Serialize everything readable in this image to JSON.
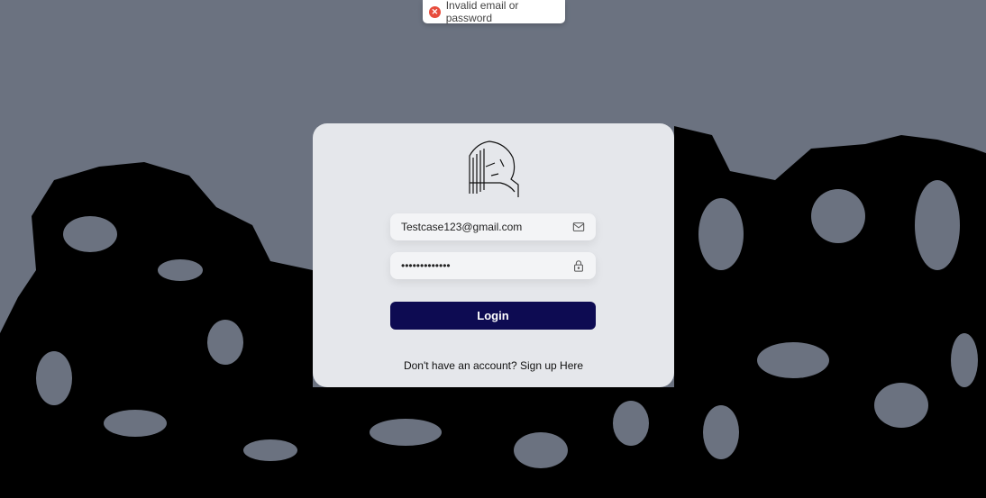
{
  "toast": {
    "message": "Invalid email or password",
    "icon": "error-circle-icon",
    "color": "#e74c3c"
  },
  "form": {
    "email_value": "Testcase123@gmail.com",
    "password_value": "•••••••••••••",
    "login_label": "Login",
    "signup_prompt": "Don't have an account?",
    "signup_link": "Sign up Here"
  },
  "colors": {
    "background": "#6b7280",
    "card": "#e5e7eb",
    "button": "#0d0b52"
  }
}
